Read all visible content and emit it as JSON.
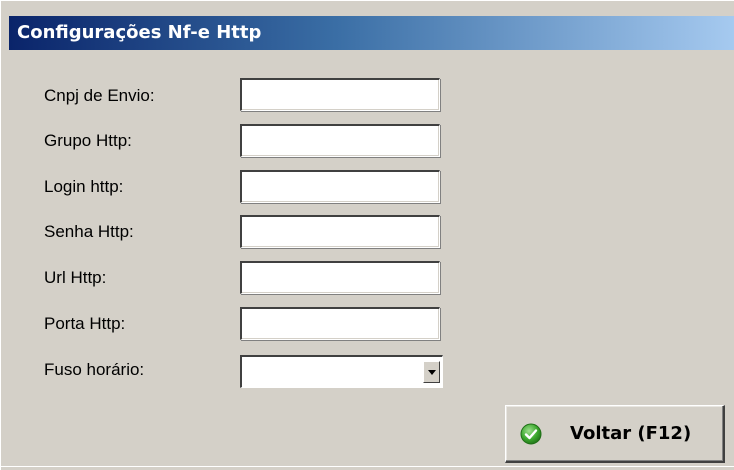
{
  "window": {
    "title": "Configurações Nf-e Http"
  },
  "form": {
    "fields": [
      {
        "label": "Cnpj de Envio:",
        "value": ""
      },
      {
        "label": "Grupo Http:",
        "value": ""
      },
      {
        "label": "Login http:",
        "value": ""
      },
      {
        "label": "Senha Http:",
        "value": ""
      },
      {
        "label": "Url Http:",
        "value": ""
      },
      {
        "label": "Porta Http:",
        "value": ""
      }
    ],
    "timezone": {
      "label": "Fuso horário:",
      "value": ""
    }
  },
  "buttons": {
    "back_label": "Voltar (F12)",
    "back_icon": "check-circle-icon"
  },
  "colors": {
    "title_gradient_start": "#0a246a",
    "title_gradient_end": "#a6caf0",
    "window_bg": "#d4d0c8",
    "check_icon_green": "#3ca82e"
  }
}
